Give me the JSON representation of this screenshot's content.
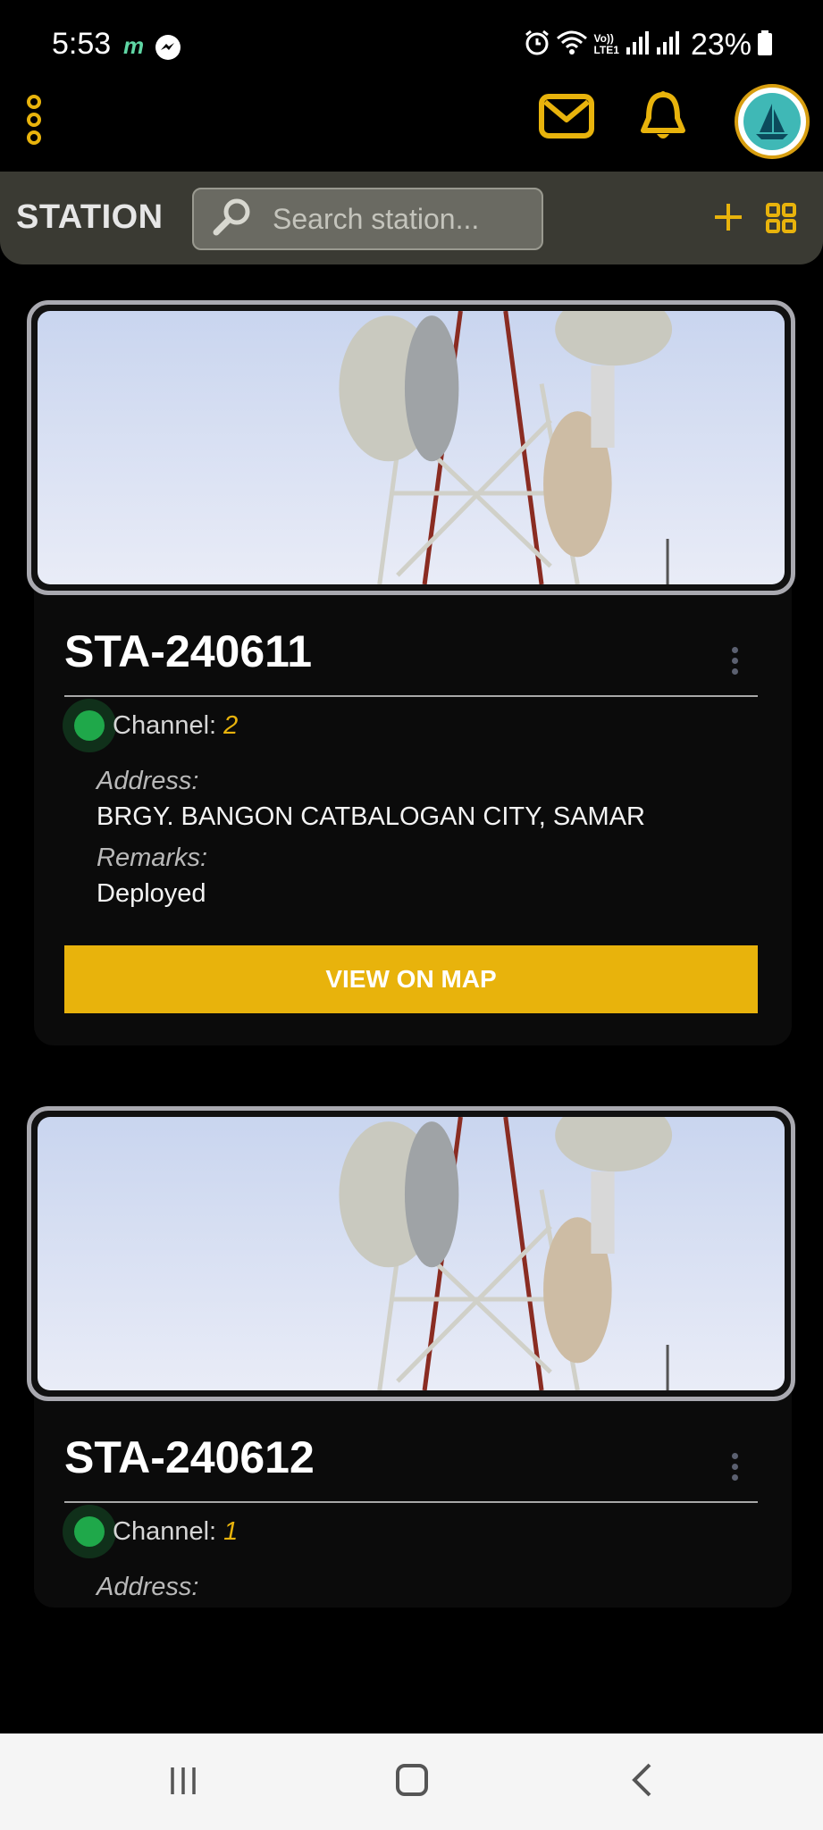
{
  "status_bar": {
    "time": "5:53",
    "m_badge": "m",
    "battery": "23%",
    "volte": "Vo))\nLTE1"
  },
  "app_bar": {
    "icons": [
      "more-vertical-icon",
      "mail-icon",
      "bell-icon",
      "avatar-logo"
    ],
    "accent_color": "#e8b30c"
  },
  "station_header": {
    "title": "STATION",
    "search_placeholder": "Search station..."
  },
  "stations": [
    {
      "id": "STA-240611",
      "channel_label": "Channel:",
      "channel": "2",
      "address_label": "Address:",
      "address": "BRGY. BANGON CATBALOGAN CITY, SAMAR",
      "remarks_label": "Remarks:",
      "remarks": "Deployed",
      "button": "VIEW ON MAP",
      "status_color": "#1fa84a"
    },
    {
      "id": "STA-240612",
      "channel_label": "Channel:",
      "channel": "1",
      "address_label": "Address:",
      "status_color": "#1fa84a"
    }
  ],
  "nav_bar": {
    "icons": [
      "recent-apps-icon",
      "home-icon",
      "back-icon"
    ]
  }
}
